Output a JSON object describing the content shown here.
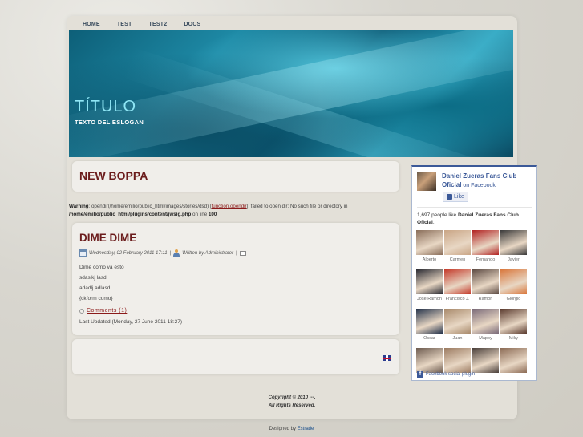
{
  "nav": {
    "items": [
      "HOME",
      "TEST",
      "TEST2",
      "DOCS"
    ]
  },
  "header": {
    "title": "TÍTULO",
    "slogan": "TEXTO DEL ESLOGAN"
  },
  "box1": {
    "title": "NEW BOPPA"
  },
  "warning": {
    "label": "Warning",
    "text1": ": opendir(/home/emilio/public_html/images/stories/dsd) [",
    "fn": "function.opendir",
    "text2": "]: failed to open dir: No such file or directory in",
    "path": "/home/emilio/public_html/plugins/content/jwsig.php",
    "text3": " on line ",
    "line": "100"
  },
  "article": {
    "title": "DIME DIME",
    "date": "Wednesday, 02 February 2011 17:11",
    "sep": "|",
    "author": "Written by Administrator",
    "sep2": "|",
    "lines": [
      "Dime como va esto",
      "sdaslkj lasd",
      "adadlj adlasd",
      "{ckform como}"
    ],
    "comments": "Comments (1)",
    "updated": "Last Updated (Monday, 27 June 2011 18:27)"
  },
  "footer": {
    "line1": "Copyright © 2010 ---.",
    "line2": "All Rights Reserved."
  },
  "designed": {
    "prefix": "Designed by ",
    "link": "Estrade"
  },
  "facebook": {
    "page_name": "Daniel Zueras Fans Club Oficial",
    "on": " on Facebook",
    "like": "Like",
    "count_prefix": "1,697 people like ",
    "count_name": "Daniel Zueras Fans Club Oficial",
    "count_suffix": ".",
    "fans": [
      {
        "name": "Alberto",
        "color": "#8a6e5a"
      },
      {
        "name": "Carmen",
        "color": "#c9a585"
      },
      {
        "name": "Fernando",
        "color": "#b22222"
      },
      {
        "name": "Javier",
        "color": "#3a3a3a"
      },
      {
        "name": "Jose Ramon",
        "color": "#2b2b33"
      },
      {
        "name": "Francisco J.",
        "color": "#c43a2a"
      },
      {
        "name": "Ramon",
        "color": "#5e4c44"
      },
      {
        "name": "Giorgio",
        "color": "#d9773c"
      },
      {
        "name": "Oscar",
        "color": "#24324a"
      },
      {
        "name": "Juan",
        "color": "#a8896a"
      },
      {
        "name": "Mappy",
        "color": "#7a6a78"
      },
      {
        "name": "Miky",
        "color": "#5a3a2e"
      },
      {
        "name": "",
        "color": "#6d5b4f"
      },
      {
        "name": "",
        "color": "#9b7a60"
      },
      {
        "name": "",
        "color": "#4a3f3a"
      },
      {
        "name": "",
        "color": "#8c6b55"
      }
    ],
    "plugin": "Facebook social plugin"
  }
}
